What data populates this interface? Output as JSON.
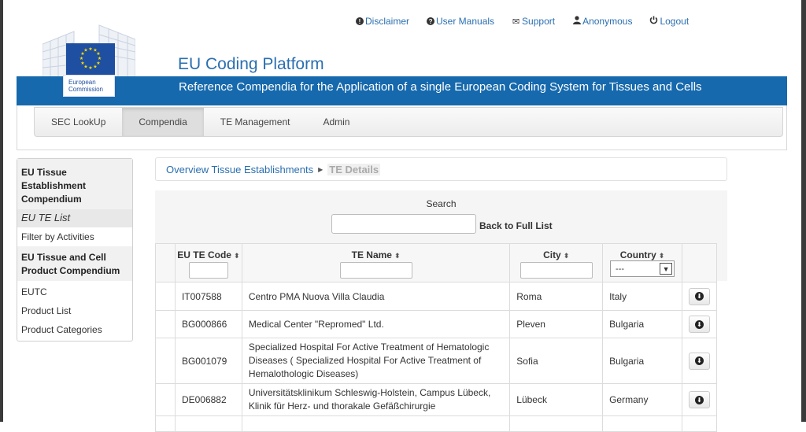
{
  "toplinks": {
    "disclaimer": "Disclaimer",
    "user_manuals": "User Manuals",
    "support": "Support",
    "anonymous": "Anonymous",
    "logout": "Logout"
  },
  "logo": {
    "line1": "European",
    "line2": "Commission"
  },
  "app_title": "EU Coding Platform",
  "banner_text": "Reference Compendia for the Application of a single European Coding System for Tissues and Cells",
  "nav": [
    {
      "label": "SEC LookUp"
    },
    {
      "label": "Compendia"
    },
    {
      "label": "TE Management"
    },
    {
      "label": "Admin"
    }
  ],
  "sidebar": {
    "section1_title": "EU Tissue Establishment Compendium",
    "te_list": "EU TE List",
    "filter_by_activities": "Filter by Activities",
    "section2_title": "EU Tissue and Cell Product Compendium",
    "eutc": "EUTC",
    "product_list": "Product List",
    "product_categories": "Product Categories"
  },
  "breadcrumb": {
    "parent": "Overview Tissue Establishments",
    "current": "TE Details"
  },
  "search": {
    "label": "Search",
    "value": "",
    "back_link": "Back to Full List"
  },
  "table": {
    "headers": {
      "code": "EU TE Code",
      "name": "TE Name",
      "city": "City",
      "country": "Country"
    },
    "country_filter_value": "---",
    "rows": [
      {
        "code": "IT007588",
        "name": "Centro PMA Nuova Villa Claudia",
        "city": "Roma",
        "country": "Italy"
      },
      {
        "code": "BG000866",
        "name": "Medical Center \"Repromed\" Ltd.",
        "city": "Pleven",
        "country": "Bulgaria"
      },
      {
        "code": "BG001079",
        "name": "Specialized Hospital For Active Treatment of Hematologic Diseases ( Specialized Hospital For Active Treatment of Hemalothologic Diseases)",
        "city": "Sofia",
        "country": "Bulgaria"
      },
      {
        "code": "DE006882",
        "name": "Universitätsklinikum Schleswig-Holstein, Campus Lübeck, Klinik für Herz- und thorakale Gefäßchirurgie",
        "city": "Lübeck",
        "country": "Germany"
      }
    ]
  },
  "colors": {
    "brand_blue": "#1669ad",
    "link_blue": "#2a6fb0",
    "flag_blue": "#1f4fa0",
    "star_yellow": "#ffdd00"
  }
}
